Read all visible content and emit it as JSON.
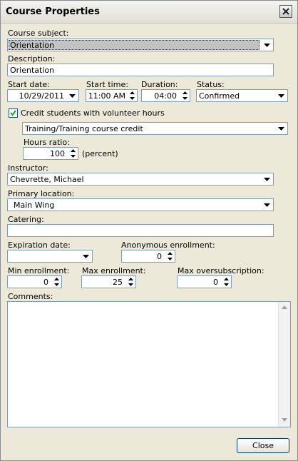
{
  "window": {
    "title": "Course Properties"
  },
  "course_subject": {
    "label": "Course subject:",
    "value": "Orientation"
  },
  "description": {
    "label": "Description:",
    "value": "Orientation"
  },
  "start_date": {
    "label": "Start date:",
    "value": "10/29/2011"
  },
  "start_time": {
    "label": "Start time:",
    "value": "11:00 AM"
  },
  "duration": {
    "label": "Duration:",
    "value": "04:00"
  },
  "status": {
    "label": "Status:",
    "value": "Confirmed"
  },
  "volunteer": {
    "checkbox_label": "Credit students with volunteer hours",
    "checked": true,
    "credit_type": "Training/Training course credit",
    "hours_ratio_label": "Hours ratio:",
    "hours_ratio_value": "100",
    "hours_ratio_unit": "(percent)"
  },
  "instructor": {
    "label": "Instructor:",
    "value": "Chevrette, Michael"
  },
  "primary_location": {
    "label": "Primary location:",
    "value": "Main Wing"
  },
  "catering": {
    "label": "Catering:",
    "value": ""
  },
  "expiration_date": {
    "label": "Expiration date:",
    "value": ""
  },
  "anonymous_enrollment": {
    "label": "Anonymous enrollment:",
    "value": "0"
  },
  "min_enrollment": {
    "label": "Min enrollment:",
    "value": "0"
  },
  "max_enrollment": {
    "label": "Max enrollment:",
    "value": "25"
  },
  "max_oversubscription": {
    "label": "Max oversubscription:",
    "value": "0"
  },
  "comments": {
    "label": "Comments:",
    "value": ""
  },
  "buttons": {
    "close": "Close"
  },
  "icons": {
    "close": "close-x-icon",
    "dropdown": "chevron-down-icon",
    "spin_up": "spin-up-icon",
    "spin_down": "spin-down-icon",
    "check": "checkmark-icon",
    "scroll_up": "scroll-up-icon",
    "scroll_down": "scroll-down-icon"
  },
  "colors": {
    "field_border": "#7f9db9",
    "window_bg": "#ece9d8",
    "check_green": "#21a121"
  }
}
